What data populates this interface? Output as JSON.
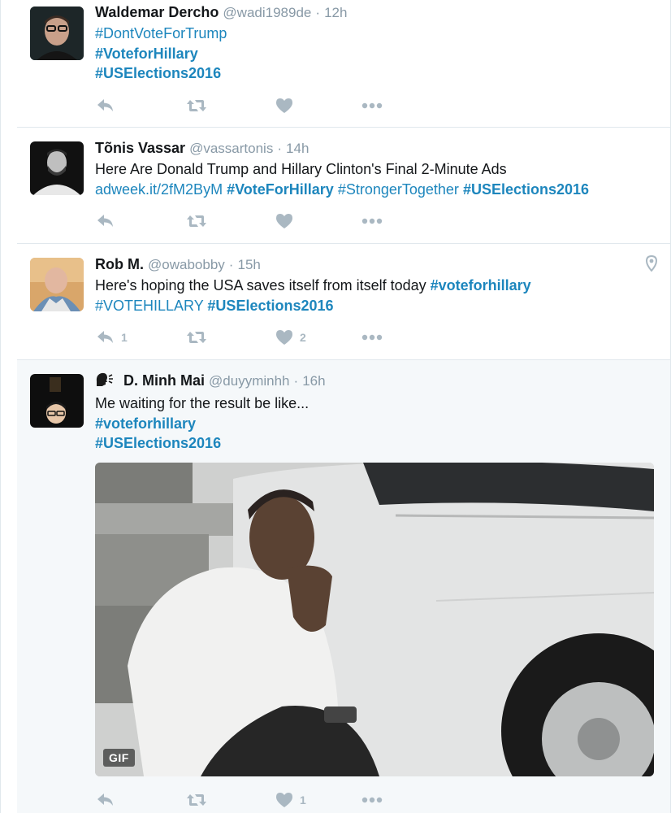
{
  "tweets": [
    {
      "name": "Waldemar Dercho",
      "handle": "@wadi1989de",
      "dot": "·",
      "time": "12h",
      "lines": [
        "#DontVoteForTrump",
        "#VoteforHillary",
        "#USElections2016"
      ],
      "reply_count": "",
      "like_count": ""
    },
    {
      "name": "Tõnis Vassar",
      "handle": "@vassartonis",
      "dot": "·",
      "time": "14h",
      "line1": "Here Are Donald Trump and Hillary Clinton's Final 2-Minute Ads",
      "link": "adweek.it/2fM2ByM",
      "tag1": "#VoteForHillary",
      "tag2": "#StrongerTogether",
      "tag3": "#USElections2016"
    },
    {
      "name": "Rob M.",
      "handle": "@owabobby",
      "dot": "·",
      "time": "15h",
      "line1_text": "Here's hoping the USA saves itself from itself today ",
      "line1_tag": "#voteforhillary",
      "line2_tag1": "#VOTEHILLARY",
      "line2_tag2": "#USElections2016",
      "reply_count": "1",
      "like_count": "2"
    },
    {
      "name": "D. Minh Mai",
      "handle": "@duyyminhh",
      "dot": "·",
      "time": "16h",
      "line1": "Me waiting for the result be like...",
      "tag1": "#voteforhillary",
      "tag2": "#USElections2016",
      "gif_label": "GIF",
      "like_count": "1"
    }
  ],
  "icons": {
    "reply": "reply-icon",
    "retweet": "retweet-icon",
    "like": "heart-icon",
    "more": "more-icon",
    "location": "location-pin-icon",
    "speech": "speaking-head-icon"
  },
  "colors": {
    "link": "#1d86bd",
    "muted": "#8899a6",
    "action": "#aab8c2",
    "border": "#e1e8ed",
    "highlight_bg": "#f5f8fa"
  }
}
